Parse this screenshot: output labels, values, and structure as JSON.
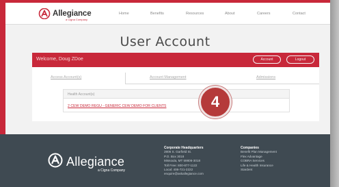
{
  "header": {
    "logo_text": "Allegiance",
    "logo_sub": "a Cigna Company",
    "nav": [
      "Home",
      "Benefits",
      "Resources",
      "About",
      "Careers",
      "Contact"
    ]
  },
  "page_title": "User Account",
  "welcome": {
    "text": "Welcome, Doug ZDoe",
    "account_button": "Account",
    "logout_button": "Logout"
  },
  "tabs": [
    "Access Account(s)",
    "Account Management",
    "Admissions"
  ],
  "accounts_table": {
    "header": "Health Account(s)",
    "link": "2 CEW DEMO REGU - GENERIC CEW DEMO FOR CLIENTS"
  },
  "step_badge": "4",
  "footer": {
    "logo_text": "Allegiance",
    "logo_sub": "a Cigna Company",
    "hq": {
      "title": "Corporate Headquarters",
      "lines": [
        "2806 S. Garfield St.",
        "P.O. Box 3018",
        "Missoula, MT 59806-3018",
        "Toll Free: 800-877-1122",
        "Local: 406-721-2222",
        "enquire@askallegiance.com"
      ]
    },
    "companies": {
      "title": "Companies",
      "lines": [
        "Benefit Plan Management",
        "Flex Advantage",
        "COBRA Services",
        "Life & Health Insurance",
        "Stardent"
      ]
    }
  },
  "colors": {
    "brand_red": "#c8283a",
    "footer_bg": "#3f4a52",
    "badge": "#b53a3a"
  }
}
